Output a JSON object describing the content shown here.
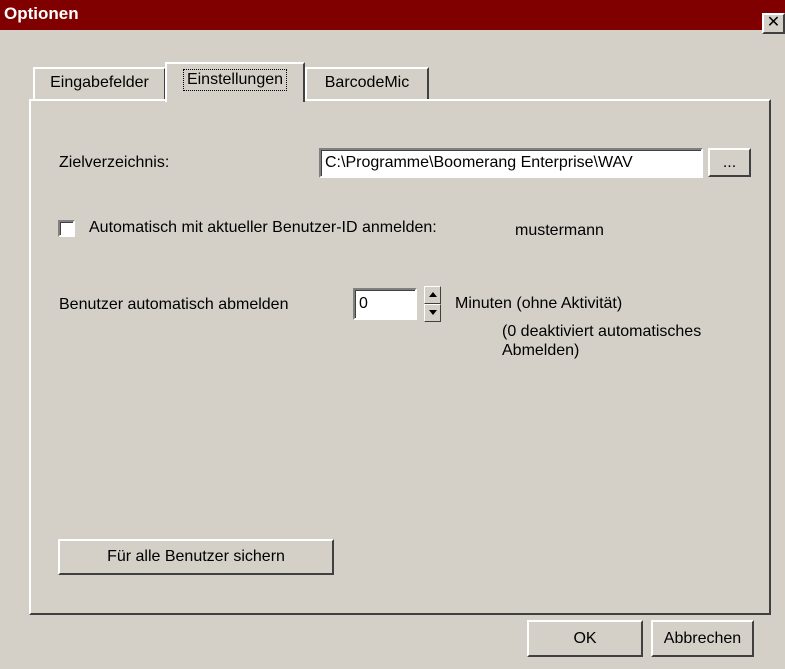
{
  "window": {
    "title": "Optionen",
    "close_glyph": "✕"
  },
  "tabs": [
    {
      "label": "Eingabefelder",
      "active": false
    },
    {
      "label": "Einstellungen",
      "active": true
    },
    {
      "label": "BarcodeMic",
      "active": false
    }
  ],
  "settings": {
    "target_dir_label": "Zielverzeichnis:",
    "target_dir_value": "C:\\Programme\\Boomerang Enterprise\\WAV",
    "browse_label": "...",
    "auto_login_label": "Automatisch mit aktueller Benutzer-ID anmelden:",
    "auto_login_checked": false,
    "user_id": "mustermann",
    "auto_logout_label": "Benutzer automatisch abmelden",
    "auto_logout_minutes": "0",
    "minutes_label": "Minuten (ohne Aktivität)",
    "hint_line1": "(0 deaktiviert automatisches",
    "hint_line2": "Abmelden)",
    "save_all_label": "Für alle Benutzer sichern"
  },
  "footer": {
    "ok_label": "OK",
    "cancel_label": "Abbrechen"
  },
  "colors": {
    "titlebar": "#800000",
    "face": "#d4d0c8"
  }
}
